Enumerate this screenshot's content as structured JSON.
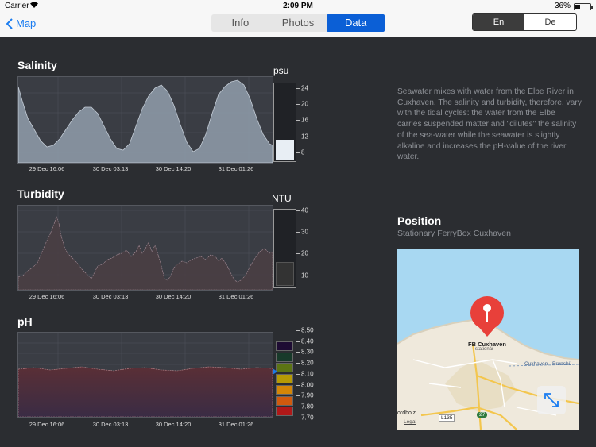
{
  "status_bar": {
    "carrier": "Carrier",
    "time": "2:09 PM",
    "battery": "36%",
    "battery_level": 0.36
  },
  "nav": {
    "back_label": "Map",
    "tabs": [
      {
        "label": "Info",
        "active": false
      },
      {
        "label": "Photos",
        "active": false
      },
      {
        "label": "Data",
        "active": true
      }
    ],
    "languages": [
      {
        "label": "En",
        "active": true
      },
      {
        "label": "De",
        "active": false
      }
    ]
  },
  "charts": {
    "salinity": {
      "title": "Salinity",
      "unit": "psu",
      "x_ticks": [
        "29 Dec 16:06",
        "30 Dec 03:13",
        "30 Dec 14:20",
        "31 Dec 01:26"
      ],
      "y_ticks": [
        "24",
        "20",
        "16",
        "12",
        "8"
      ],
      "current": 11
    },
    "turbidity": {
      "title": "Turbidity",
      "unit": "NTU",
      "x_ticks": [
        "29 Dec 16:06",
        "30 Dec 03:13",
        "30 Dec 14:20",
        "31 Dec 01:26"
      ],
      "y_ticks": [
        "40",
        "30",
        "20",
        "10"
      ],
      "current": 17
    },
    "ph": {
      "title": "pH",
      "x_ticks": [
        "29 Dec 16:06",
        "30 Dec 03:13",
        "30 Dec 14:20",
        "31 Dec 01:26"
      ],
      "y_ticks": [
        "8.50",
        "8.40",
        "8.30",
        "8.20",
        "8.10",
        "8.00",
        "7.90",
        "7.80",
        "7.70"
      ],
      "current": 8.12,
      "swatch_colors": [
        "#1e0c33",
        "#183a2a",
        "#5c7414",
        "#b69a05",
        "#d48607",
        "#d05a0e",
        "#b01818"
      ]
    }
  },
  "description": "Seawater mixes with water from the Elbe River in Cuxhaven. The salinity and turbidity, therefore, vary with the tidal cycles: the water from the Elbe carries suspended matter and \"dilutes\" the salinity of the sea-water while the seawater is slightly alkaline and increases the pH-value of the river water.",
  "position": {
    "title": "Position",
    "subtitle": "Stationary FerryBox Cuxhaven",
    "map": {
      "pin_title": "FB Cuxhaven",
      "pin_subtitle": "stationär",
      "road_label": "Cuxhaven - Brunsbü",
      "place_label": "ordholz",
      "route_l135": "L135",
      "route_27": "27",
      "legal": "Legal"
    }
  }
}
